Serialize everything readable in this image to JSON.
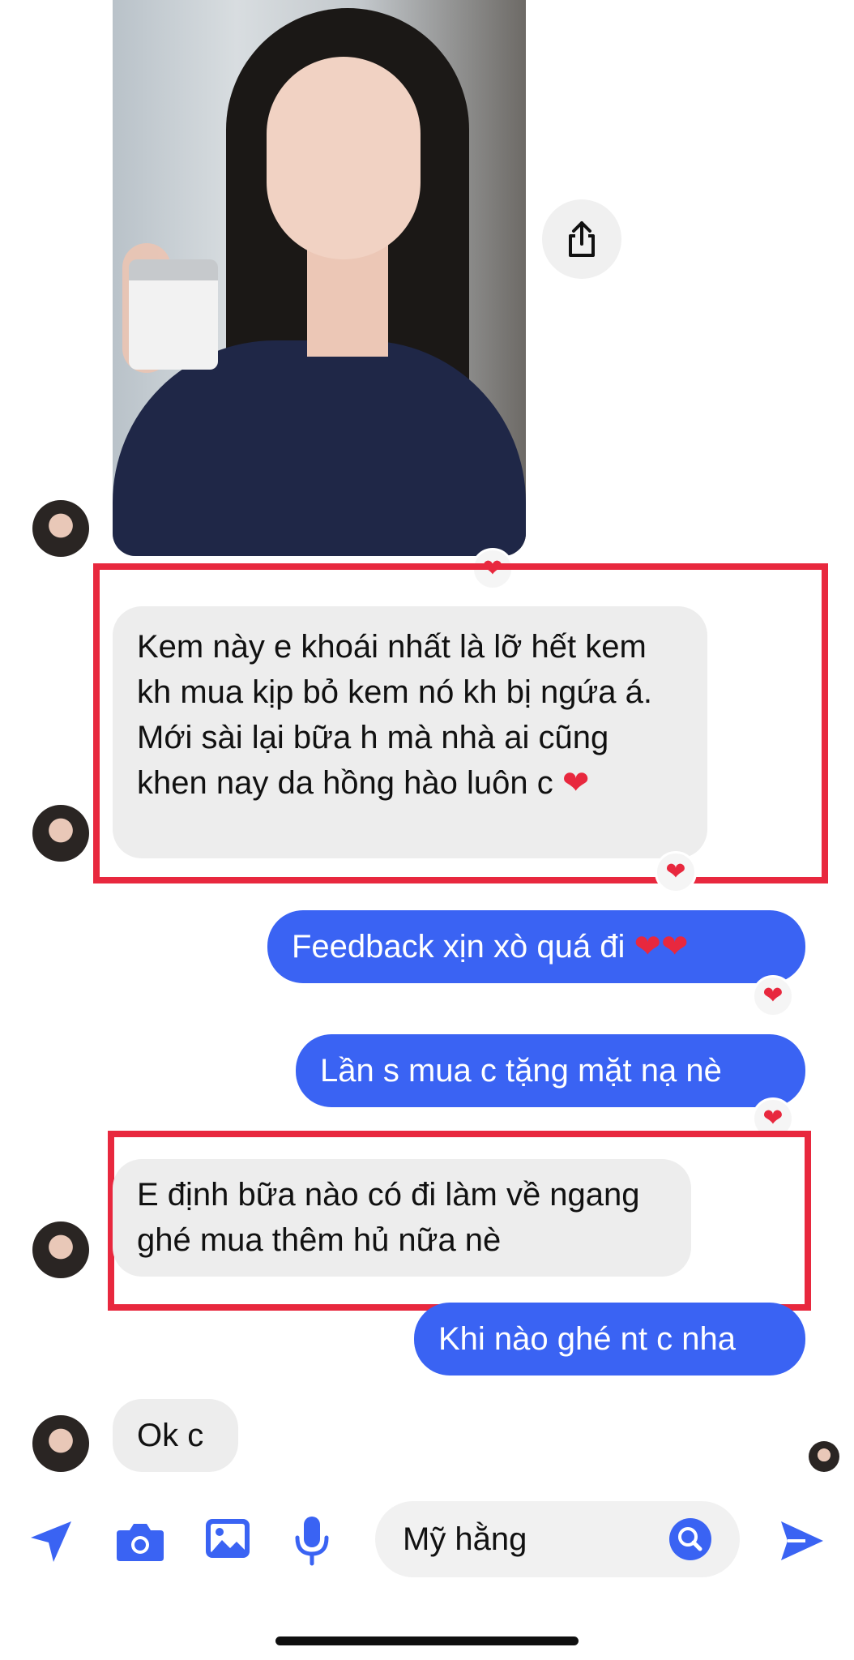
{
  "messages": {
    "m1": {
      "text": "Kem này e khoái nhất là lỡ hết kem kh mua kịp bỏ kem nó kh bị ngứa á. Mới sài lại bữa h mà nhà ai cũng khen nay da hồng hào luôn c"
    },
    "m2": {
      "text": "Feedback xịn xò quá đi"
    },
    "m3": {
      "text": "Lần s mua c tặng mặt nạ nè"
    },
    "m4": {
      "text": "E định bữa nào có đi làm về ngang ghé mua thêm hủ nữa nè"
    },
    "m5": {
      "text": "Khi nào ghé nt c nha"
    },
    "m6": {
      "text": "Ok c"
    }
  },
  "reactions": {
    "heart": "❤"
  },
  "composer": {
    "input_value": "Mỹ hằng"
  },
  "colors": {
    "accent": "#3a63f3",
    "highlight": "#e8283e",
    "incoming_bubble": "#ededed"
  },
  "icons": [
    "share-icon",
    "location-arrow-icon",
    "camera-icon",
    "image-icon",
    "microphone-icon",
    "search-icon",
    "send-icon"
  ]
}
